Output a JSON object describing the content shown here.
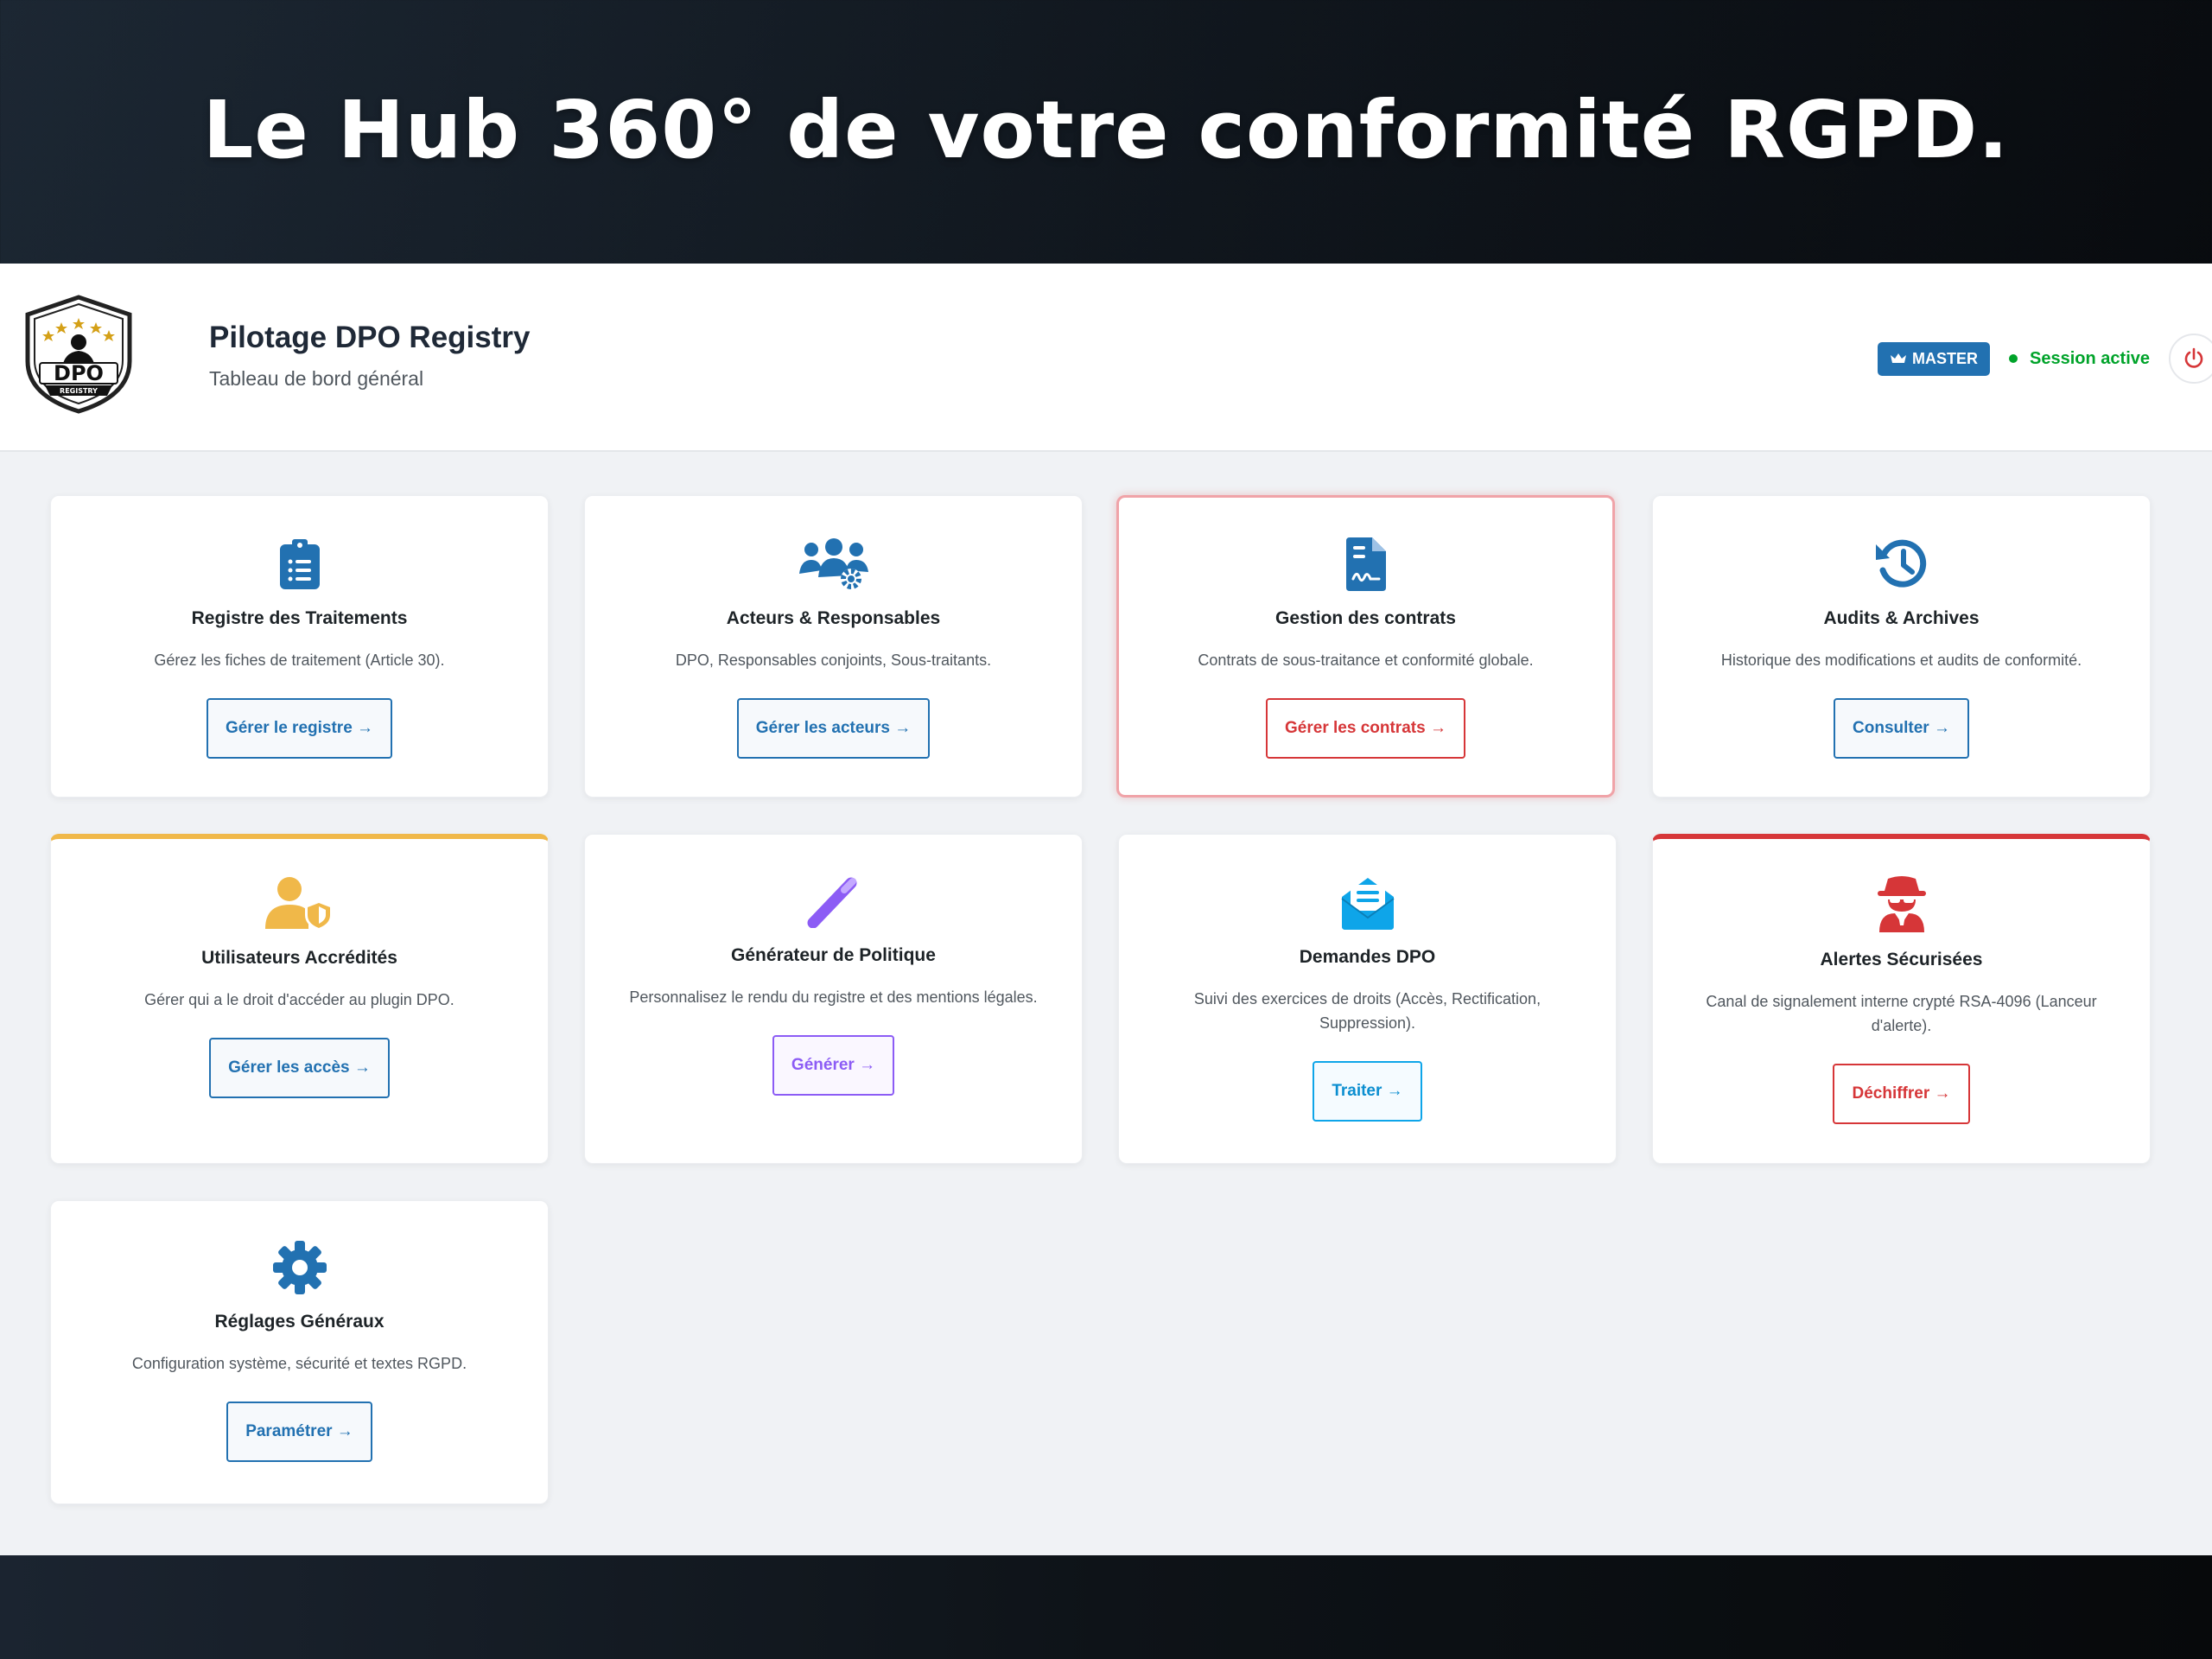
{
  "hero": {
    "title": "Le Hub 360° de votre conformité RGPD."
  },
  "header": {
    "logo_text": "DPO",
    "logo_subtext": "REGISTRY",
    "title": "Pilotage DPO Registry",
    "subtitle": "Tableau de bord général",
    "badge": "MASTER",
    "session_status": "Session active"
  },
  "colors": {
    "primary": "#2271b1",
    "danger": "#d63638",
    "warning": "#f0b849",
    "purple": "#8c5cf5",
    "cyan": "#0ea5e9",
    "success": "#00a32a"
  },
  "cards": [
    {
      "icon": "clipboard-list-icon",
      "title": "Registre des Traitements",
      "description": "Gérez les fiches de traitement (Article 30).",
      "button": "Gérer le registre →"
    },
    {
      "icon": "users-gear-icon",
      "title": "Acteurs & Responsables",
      "description": "DPO, Responsables conjoints, Sous-traitants.",
      "button": "Gérer les acteurs →"
    },
    {
      "icon": "file-contract-icon",
      "title": "Gestion des contrats",
      "description": "Contrats de sous-traitance et conformité globale.",
      "button": "Gérer les contrats →"
    },
    {
      "icon": "history-icon",
      "title": "Audits & Archives",
      "description": "Historique des modifications et audits de conformité.",
      "button": "Consulter →"
    },
    {
      "icon": "user-shield-icon",
      "title": "Utilisateurs Accrédités",
      "description": "Gérer qui a le droit d'accéder au plugin DPO.",
      "button": "Gérer les accès →"
    },
    {
      "icon": "magic-wand-icon",
      "title": "Générateur de Politique",
      "description": "Personnalisez le rendu du registre et des mentions légales.",
      "button": "Générer →"
    },
    {
      "icon": "envelope-open-icon",
      "title": "Demandes DPO",
      "description": "Suivi des exercices de droits (Accès, Rectification, Suppression).",
      "button": "Traiter →"
    },
    {
      "icon": "user-secret-icon",
      "title": "Alertes Sécurisées",
      "description": "Canal de signalement interne crypté RSA-4096 (Lanceur d'alerte).",
      "button": "Déchiffrer →"
    },
    {
      "icon": "gear-icon",
      "title": "Réglages Généraux",
      "description": "Configuration système, sécurité et textes RGPD.",
      "button": "Paramétrer →"
    }
  ]
}
